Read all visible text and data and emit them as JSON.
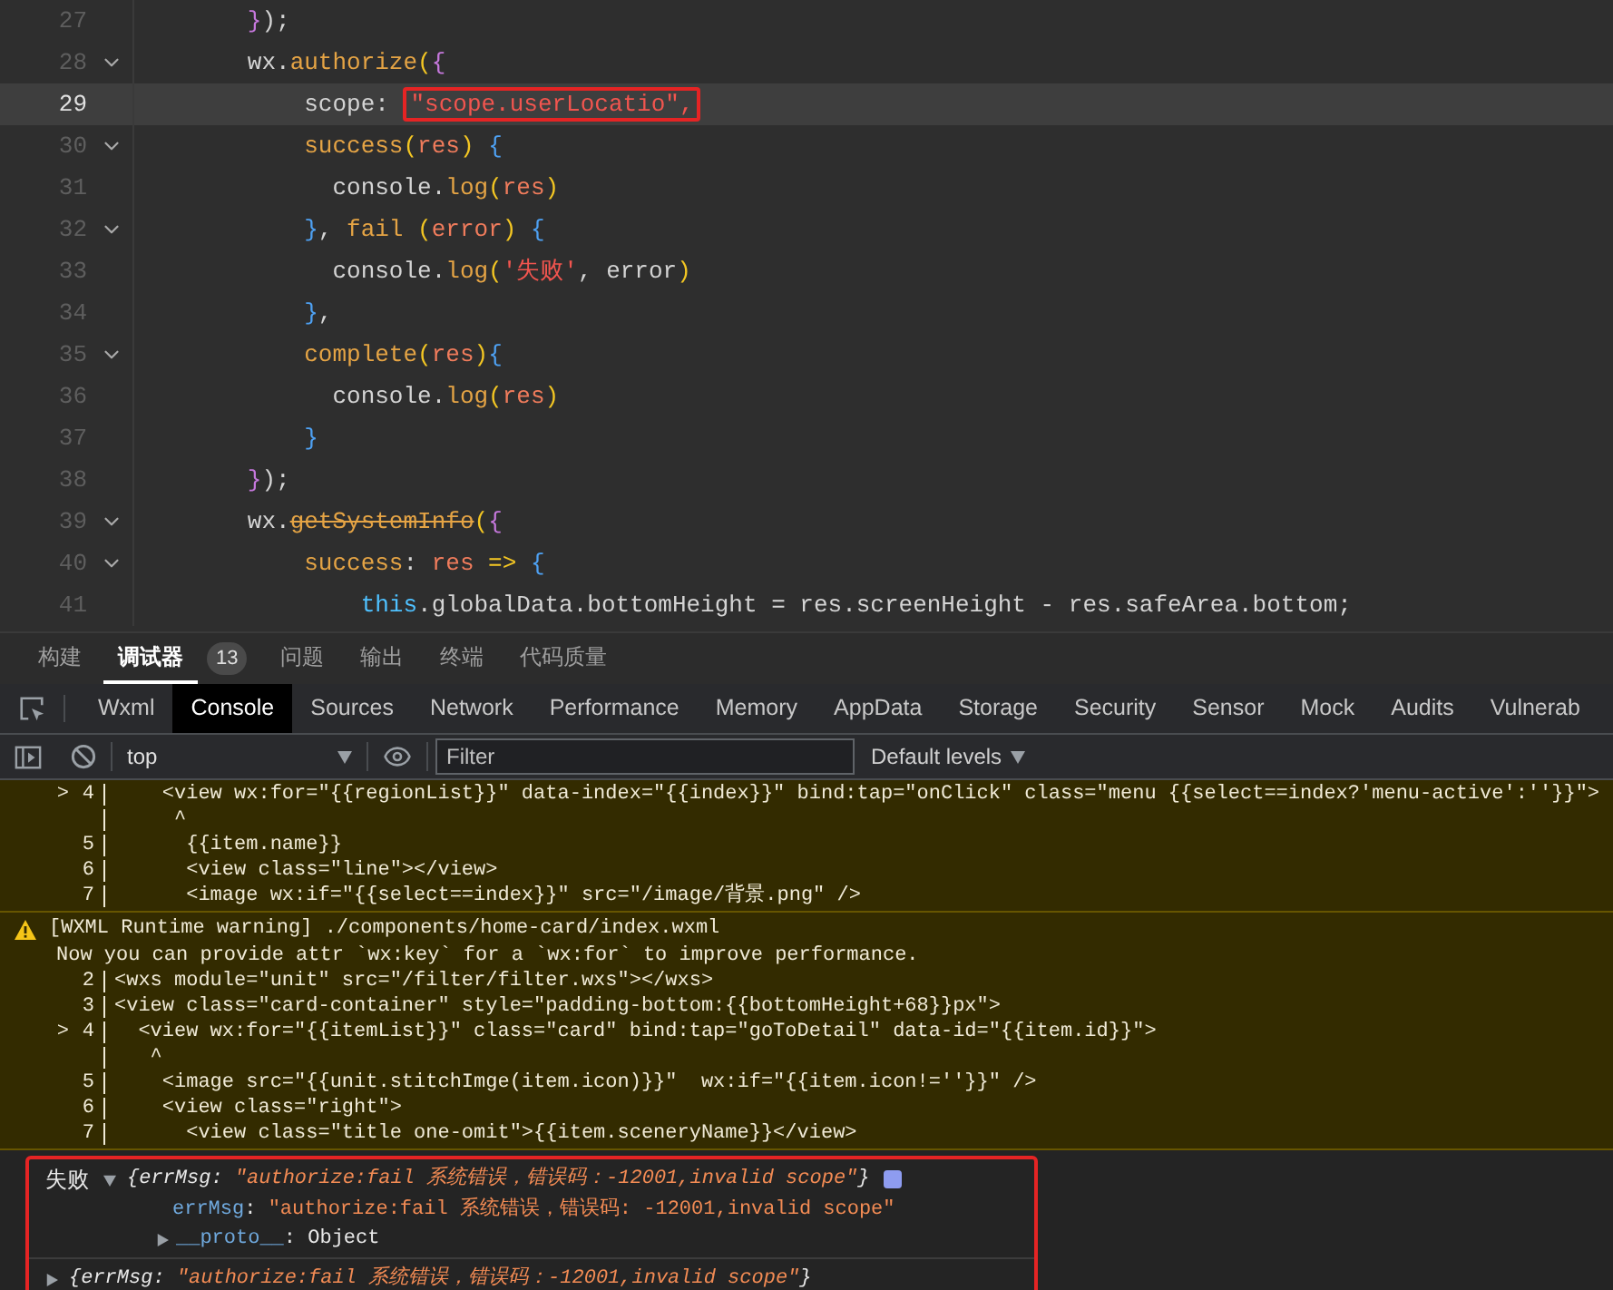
{
  "editor": {
    "lines": [
      {
        "number": "27",
        "foldable": false,
        "active": false,
        "tokens": [
          {
            "text": "        }",
            "kind": "brace2"
          },
          {
            "text": ");",
            "kind": "plain"
          }
        ]
      },
      {
        "number": "28",
        "foldable": true,
        "active": false,
        "tokens": [
          {
            "text": "        wx.",
            "kind": "plain"
          },
          {
            "text": "authorize",
            "kind": "func"
          },
          {
            "text": "(",
            "kind": "paren"
          },
          {
            "text": "{",
            "kind": "brace2"
          }
        ]
      },
      {
        "number": "29",
        "foldable": false,
        "active": true,
        "tokens": [
          {
            "text": "            scope: ",
            "kind": "plain"
          },
          {
            "text": "\"scope.userLocatio\",",
            "kind": "string",
            "boxed": true
          }
        ]
      },
      {
        "number": "30",
        "foldable": true,
        "active": false,
        "tokens": [
          {
            "text": "            success",
            "kind": "func"
          },
          {
            "text": "(",
            "kind": "paren"
          },
          {
            "text": "res",
            "kind": "param"
          },
          {
            "text": ")",
            "kind": "paren"
          },
          {
            "text": " {",
            "kind": "brace"
          }
        ]
      },
      {
        "number": "31",
        "foldable": false,
        "active": false,
        "tokens": [
          {
            "text": "              console.",
            "kind": "plain"
          },
          {
            "text": "log",
            "kind": "func"
          },
          {
            "text": "(",
            "kind": "paren"
          },
          {
            "text": "res",
            "kind": "param"
          },
          {
            "text": ")",
            "kind": "paren"
          }
        ]
      },
      {
        "number": "32",
        "foldable": true,
        "active": false,
        "tokens": [
          {
            "text": "            }",
            "kind": "brace"
          },
          {
            "text": ", ",
            "kind": "plain"
          },
          {
            "text": "fail",
            "kind": "func"
          },
          {
            "text": " (",
            "kind": "paren"
          },
          {
            "text": "error",
            "kind": "param"
          },
          {
            "text": ")",
            "kind": "paren"
          },
          {
            "text": " {",
            "kind": "brace"
          }
        ]
      },
      {
        "number": "33",
        "foldable": false,
        "active": false,
        "tokens": [
          {
            "text": "              console.",
            "kind": "plain"
          },
          {
            "text": "log",
            "kind": "func"
          },
          {
            "text": "(",
            "kind": "paren"
          },
          {
            "text": "'失败'",
            "kind": "string"
          },
          {
            "text": ", error",
            "kind": "plain"
          },
          {
            "text": ")",
            "kind": "paren"
          }
        ]
      },
      {
        "number": "34",
        "foldable": false,
        "active": false,
        "tokens": [
          {
            "text": "            }",
            "kind": "brace"
          },
          {
            "text": ",",
            "kind": "plain"
          }
        ]
      },
      {
        "number": "35",
        "foldable": true,
        "active": false,
        "tokens": [
          {
            "text": "            complete",
            "kind": "func"
          },
          {
            "text": "(",
            "kind": "paren"
          },
          {
            "text": "res",
            "kind": "param"
          },
          {
            "text": ")",
            "kind": "paren"
          },
          {
            "text": "{",
            "kind": "brace"
          }
        ]
      },
      {
        "number": "36",
        "foldable": false,
        "active": false,
        "tokens": [
          {
            "text": "              console.",
            "kind": "plain"
          },
          {
            "text": "log",
            "kind": "func"
          },
          {
            "text": "(",
            "kind": "paren"
          },
          {
            "text": "res",
            "kind": "param"
          },
          {
            "text": ")",
            "kind": "paren"
          }
        ]
      },
      {
        "number": "37",
        "foldable": false,
        "active": false,
        "tokens": [
          {
            "text": "            }",
            "kind": "brace"
          }
        ]
      },
      {
        "number": "38",
        "foldable": false,
        "active": false,
        "tokens": [
          {
            "text": "        }",
            "kind": "brace2"
          },
          {
            "text": ");",
            "kind": "plain"
          }
        ]
      },
      {
        "number": "39",
        "foldable": true,
        "active": false,
        "tokens": [
          {
            "text": "        wx.",
            "kind": "plain"
          },
          {
            "text": "getSystemInfo",
            "kind": "deprecated"
          },
          {
            "text": "(",
            "kind": "paren"
          },
          {
            "text": "{",
            "kind": "brace2"
          }
        ]
      },
      {
        "number": "40",
        "foldable": true,
        "active": false,
        "tokens": [
          {
            "text": "            success",
            "kind": "func"
          },
          {
            "text": ": ",
            "kind": "plain"
          },
          {
            "text": "res",
            "kind": "param"
          },
          {
            "text": " =>",
            "kind": "op"
          },
          {
            "text": " {",
            "kind": "brace"
          }
        ]
      },
      {
        "number": "41",
        "foldable": false,
        "active": false,
        "tokens": [
          {
            "text": "                this",
            "kind": "this"
          },
          {
            "text": ".globalData.bottomHeight = res.screenHeight - res.safeArea.bottom;",
            "kind": "plain"
          }
        ]
      }
    ]
  },
  "panel_tabs": [
    {
      "label": "构建",
      "selected": false
    },
    {
      "label": "调试器",
      "selected": true,
      "badge": "13"
    },
    {
      "label": "问题",
      "selected": false
    },
    {
      "label": "输出",
      "selected": false
    },
    {
      "label": "终端",
      "selected": false
    },
    {
      "label": "代码质量",
      "selected": false
    }
  ],
  "devtools_tabs": [
    {
      "label": "Wxml",
      "selected": false
    },
    {
      "label": "Console",
      "selected": true
    },
    {
      "label": "Sources",
      "selected": false
    },
    {
      "label": "Network",
      "selected": false
    },
    {
      "label": "Performance",
      "selected": false
    },
    {
      "label": "Memory",
      "selected": false
    },
    {
      "label": "AppData",
      "selected": false
    },
    {
      "label": "Storage",
      "selected": false
    },
    {
      "label": "Security",
      "selected": false
    },
    {
      "label": "Sensor",
      "selected": false
    },
    {
      "label": "Mock",
      "selected": false
    },
    {
      "label": "Audits",
      "selected": false
    },
    {
      "label": "Vulnerab",
      "selected": false
    }
  ],
  "toolbar": {
    "context": "top",
    "filter": {
      "placeholder": "Filter"
    },
    "levels": "Default levels"
  },
  "console": {
    "messages": [
      {
        "kind": "warning",
        "rows": [
          {
            "marker": ">",
            "number": "4",
            "code": "    <view wx:for=\"{{regionList}}\" data-index=\"{{index}}\" bind:tap=\"onClick\" class=\"menu {{select==index?'menu-active':''}}\">"
          },
          {
            "code": "     ^"
          },
          {
            "number": "5",
            "code": "      {{item.name}}"
          },
          {
            "number": "6",
            "code": "      <view class=\"line\"></view>"
          },
          {
            "number": "7",
            "code": "      <image wx:if=\"{{select==index}}\" src=\"/image/背景.png\" />"
          }
        ]
      },
      {
        "kind": "warning",
        "title": "[WXML Runtime warning] ./components/home-card/index.wxml",
        "message": "Now you can provide attr `wx:key` for a `wx:for` to improve performance.",
        "rows": [
          {
            "number": "2",
            "code": "<wxs module=\"unit\" src=\"/filter/filter.wxs\"></wxs>"
          },
          {
            "number": "3",
            "code": "<view class=\"card-container\" style=\"padding-bottom:{{bottomHeight+68}}px\">"
          },
          {
            "marker": ">",
            "number": "4",
            "code": "  <view wx:for=\"{{itemList}}\" class=\"card\" bind:tap=\"goToDetail\" data-id=\"{{item.id}}\">"
          },
          {
            "code": "   ^"
          },
          {
            "number": "5",
            "code": "    <image src=\"{{unit.stitchImge(item.icon)}}\"  wx:if=\"{{item.icon!=''}}\" />"
          },
          {
            "number": "6",
            "code": "    <view class=\"right\">"
          },
          {
            "number": "7",
            "code": "      <view class=\"title one-omit\">{{item.sceneryName}}</view>"
          }
        ]
      }
    ],
    "logs": [
      {
        "label": "失败",
        "expanded": true,
        "info_badge": true,
        "preview": [
          {
            "text": "{errMsg: ",
            "kind": "key"
          },
          {
            "text": "\"authorize:fail 系统错误，错误码：-12001,invalid scope\"",
            "kind": "string"
          },
          {
            "text": "}",
            "kind": "key"
          }
        ],
        "properties": [
          {
            "key": "errMsg",
            "separator": ": ",
            "value": "\"authorize:fail 系统错误，错误码: -12001,invalid scope\""
          }
        ],
        "proto": {
          "key": "__proto__",
          "separator": ": ",
          "value": "Object"
        }
      },
      {
        "expanded": false,
        "info_badge": false,
        "preview": [
          {
            "text": "{errMsg: ",
            "kind": "key"
          },
          {
            "text": "\"authorize:fail 系统错误，错误码：-12001,invalid scope\"",
            "kind": "string"
          },
          {
            "text": "}",
            "kind": "key"
          }
        ]
      }
    ]
  }
}
